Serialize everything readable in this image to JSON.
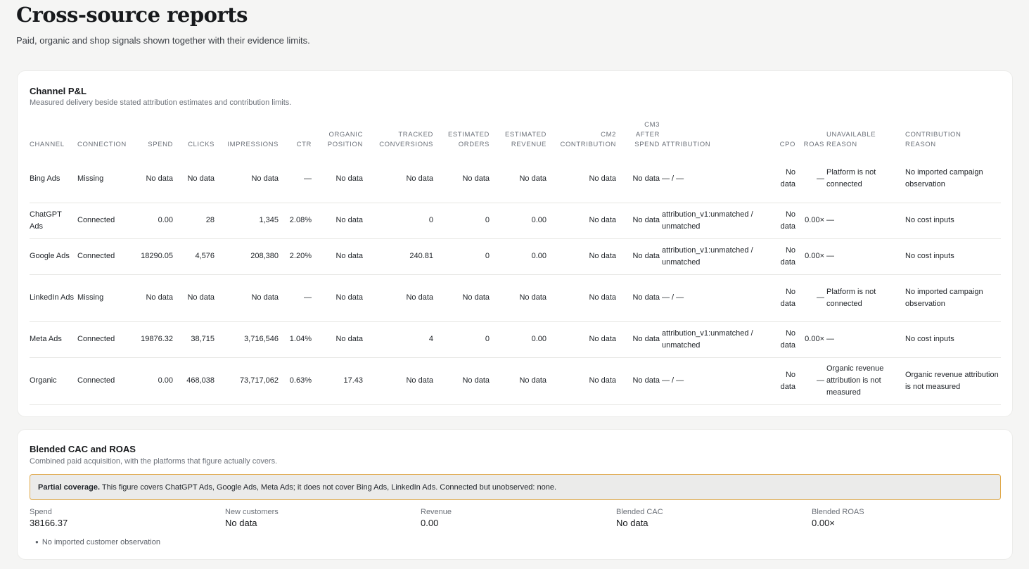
{
  "page": {
    "title": "Cross-source reports",
    "subtitle": "Paid, organic and shop signals shown together with their evidence limits."
  },
  "channel_pl": {
    "title": "Channel P&L",
    "subtitle": "Measured delivery beside stated attribution estimates and contribution limits.",
    "columns": [
      {
        "key": "channel",
        "lines": [
          "CHANNEL"
        ]
      },
      {
        "key": "connection",
        "lines": [
          "CONNECTION"
        ]
      },
      {
        "key": "spend",
        "lines": [
          "SPEND"
        ]
      },
      {
        "key": "clicks",
        "lines": [
          "CLICKS"
        ]
      },
      {
        "key": "impressions",
        "lines": [
          "IMPRESSIONS"
        ]
      },
      {
        "key": "ctr",
        "lines": [
          "CTR"
        ]
      },
      {
        "key": "organic_position",
        "lines": [
          "ORGANIC",
          "POSITION"
        ]
      },
      {
        "key": "tracked_conversions",
        "lines": [
          "TRACKED",
          "CONVERSIONS"
        ]
      },
      {
        "key": "estimated_orders",
        "lines": [
          "ESTIMATED",
          "ORDERS"
        ]
      },
      {
        "key": "estimated_revenue",
        "lines": [
          "ESTIMATED",
          "REVENUE"
        ]
      },
      {
        "key": "cm2",
        "lines": [
          "CM2",
          "CONTRIBUTION"
        ]
      },
      {
        "key": "cm3",
        "lines": [
          "CM3",
          "AFTER",
          "SPEND"
        ]
      },
      {
        "key": "attribution",
        "lines": [
          "ATTRIBUTION"
        ]
      },
      {
        "key": "cpo",
        "lines": [
          "CPO"
        ]
      },
      {
        "key": "roas",
        "lines": [
          "ROAS"
        ]
      },
      {
        "key": "unavailable_reason",
        "lines": [
          "UNAVAILABLE",
          "REASON"
        ]
      },
      {
        "key": "contribution_reason",
        "lines": [
          "CONTRIBUTION",
          "REASON"
        ]
      }
    ],
    "rows": [
      {
        "size": "tall",
        "channel": "Bing Ads",
        "connection": "Missing",
        "spend": "No data",
        "clicks": "No data",
        "impressions": "No data",
        "ctr": "—",
        "organic_position": "No data",
        "tracked_conversions": "No data",
        "estimated_orders": "No data",
        "estimated_revenue": "No data",
        "cm2": "No data",
        "cm3": "No data",
        "attribution": "— / —",
        "cpo": "No data",
        "roas": "—",
        "unavailable_reason": "Platform is not connected",
        "contribution_reason": "No imported campaign observation"
      },
      {
        "size": "med",
        "channel": "ChatGPT Ads",
        "connection": "Connected",
        "spend": "0.00",
        "clicks": "28",
        "impressions": "1,345",
        "ctr": "2.08%",
        "organic_position": "No data",
        "tracked_conversions": "0",
        "estimated_orders": "0",
        "estimated_revenue": "0.00",
        "cm2": "No data",
        "cm3": "No data",
        "attribution": "attribution_v1:unmatched / unmatched",
        "cpo": "No data",
        "roas": "0.00×",
        "unavailable_reason": "—",
        "contribution_reason": "No cost inputs"
      },
      {
        "size": "med",
        "channel": "Google Ads",
        "connection": "Connected",
        "spend": "18290.05",
        "clicks": "4,576",
        "impressions": "208,380",
        "ctr": "2.20%",
        "organic_position": "No data",
        "tracked_conversions": "240.81",
        "estimated_orders": "0",
        "estimated_revenue": "0.00",
        "cm2": "No data",
        "cm3": "No data",
        "attribution": "attribution_v1:unmatched / unmatched",
        "cpo": "No data",
        "roas": "0.00×",
        "unavailable_reason": "—",
        "contribution_reason": "No cost inputs"
      },
      {
        "size": "tall",
        "channel": "LinkedIn Ads",
        "connection": "Missing",
        "spend": "No data",
        "clicks": "No data",
        "impressions": "No data",
        "ctr": "—",
        "organic_position": "No data",
        "tracked_conversions": "No data",
        "estimated_orders": "No data",
        "estimated_revenue": "No data",
        "cm2": "No data",
        "cm3": "No data",
        "attribution": "— / —",
        "cpo": "No data",
        "roas": "—",
        "unavailable_reason": "Platform is not connected",
        "contribution_reason": "No imported campaign observation"
      },
      {
        "size": "med",
        "channel": "Meta Ads",
        "connection": "Connected",
        "spend": "19876.32",
        "clicks": "38,715",
        "impressions": "3,716,546",
        "ctr": "1.04%",
        "organic_position": "No data",
        "tracked_conversions": "4",
        "estimated_orders": "0",
        "estimated_revenue": "0.00",
        "cm2": "No data",
        "cm3": "No data",
        "attribution": "attribution_v1:unmatched / unmatched",
        "cpo": "No data",
        "roas": "0.00×",
        "unavailable_reason": "—",
        "contribution_reason": "No cost inputs"
      },
      {
        "size": "tall",
        "channel": "Organic",
        "connection": "Connected",
        "spend": "0.00",
        "clicks": "468,038",
        "impressions": "73,717,062",
        "ctr": "0.63%",
        "organic_position": "17.43",
        "tracked_conversions": "No data",
        "estimated_orders": "No data",
        "estimated_revenue": "No data",
        "cm2": "No data",
        "cm3": "No data",
        "attribution": "— / —",
        "cpo": "No data",
        "roas": "—",
        "unavailable_reason": "Organic revenue attribution is not measured",
        "contribution_reason": "Organic revenue attribution is not measured"
      }
    ]
  },
  "blended": {
    "title": "Blended CAC and ROAS",
    "subtitle": "Combined paid acquisition, with the platforms that figure actually covers.",
    "coverage_label": "Partial coverage.",
    "coverage_text": " This figure covers ChatGPT Ads, Google Ads, Meta Ads; it does not cover Bing Ads, LinkedIn Ads. Connected but unobserved: none.",
    "metrics": [
      {
        "label": "Spend",
        "value": "38166.37"
      },
      {
        "label": "New customers",
        "value": "No data"
      },
      {
        "label": "Revenue",
        "value": "0.00"
      },
      {
        "label": "Blended CAC",
        "value": "No data"
      },
      {
        "label": "Blended ROAS",
        "value": "0.00×"
      }
    ],
    "note": "No imported customer observation"
  }
}
